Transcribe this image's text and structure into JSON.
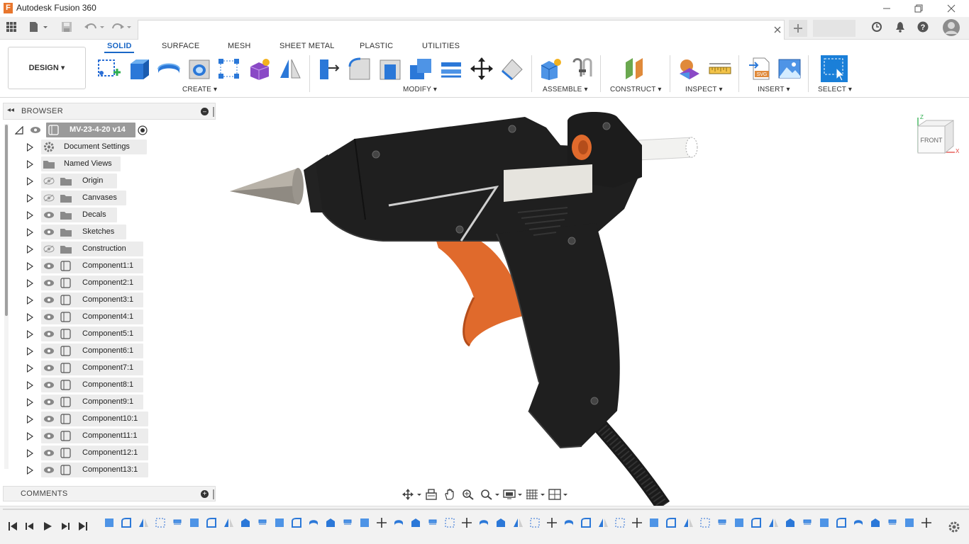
{
  "window": {
    "title": "Autodesk Fusion 360",
    "controls": [
      "minimize",
      "restore",
      "close"
    ]
  },
  "tabbar": {
    "icons": [
      "apps-grid-icon",
      "file-icon",
      "save-icon",
      "undo-icon",
      "redo-icon",
      "close-tab-icon",
      "new-tab-icon",
      "job-status-icon",
      "notifications-icon",
      "help-icon",
      "user-avatar"
    ]
  },
  "workspace": {
    "label": "DESIGN ▾"
  },
  "ribbon_tabs": [
    {
      "label": "SOLID",
      "active": true
    },
    {
      "label": "SURFACE",
      "active": false
    },
    {
      "label": "MESH",
      "active": false
    },
    {
      "label": "SHEET METAL",
      "active": false
    },
    {
      "label": "PLASTIC",
      "active": false
    },
    {
      "label": "UTILITIES",
      "active": false
    }
  ],
  "groups": {
    "create": "CREATE ▾",
    "modify": "MODIFY ▾",
    "assemble": "ASSEMBLE ▾",
    "construct": "CONSTRUCT ▾",
    "inspect": "INSPECT ▾",
    "insert": "INSERT ▾",
    "select": "SELECT ▾"
  },
  "browser": {
    "title": "BROWSER",
    "root": "MV-23-4-20 v14",
    "items": [
      {
        "label": "Document Settings",
        "icon": "gear-icon",
        "visibility": "none"
      },
      {
        "label": "Named Views",
        "icon": "folder-icon",
        "visibility": "none"
      },
      {
        "label": "Origin",
        "icon": "folder-icon",
        "visibility": "hidden"
      },
      {
        "label": "Canvases",
        "icon": "folder-icon",
        "visibility": "hidden"
      },
      {
        "label": "Decals",
        "icon": "folder-icon",
        "visibility": "visible"
      },
      {
        "label": "Sketches",
        "icon": "folder-icon",
        "visibility": "visible"
      },
      {
        "label": "Construction",
        "icon": "folder-icon",
        "visibility": "hidden"
      },
      {
        "label": "Component1:1",
        "icon": "component-icon",
        "visibility": "visible"
      },
      {
        "label": "Component2:1",
        "icon": "component-icon",
        "visibility": "visible"
      },
      {
        "label": "Component3:1",
        "icon": "component-icon",
        "visibility": "visible"
      },
      {
        "label": "Component4:1",
        "icon": "component-icon",
        "visibility": "visible"
      },
      {
        "label": "Component5:1",
        "icon": "component-icon",
        "visibility": "visible"
      },
      {
        "label": "Component6:1",
        "icon": "component-icon",
        "visibility": "visible"
      },
      {
        "label": "Component7:1",
        "icon": "component-icon",
        "visibility": "visible"
      },
      {
        "label": "Component8:1",
        "icon": "component-icon",
        "visibility": "visible"
      },
      {
        "label": "Component9:1",
        "icon": "component-icon",
        "visibility": "visible"
      },
      {
        "label": "Component10:1",
        "icon": "component-icon",
        "visibility": "visible"
      },
      {
        "label": "Component11:1",
        "icon": "component-icon",
        "visibility": "visible"
      },
      {
        "label": "Component12:1",
        "icon": "component-icon",
        "visibility": "visible"
      },
      {
        "label": "Component13:1",
        "icon": "component-icon",
        "visibility": "visible"
      }
    ]
  },
  "comments": {
    "title": "COMMENTS"
  },
  "viewcube": {
    "top_axis": "Z",
    "face": "FRONT",
    "side_axis": "X"
  },
  "model": {
    "description": "glue-gun-model",
    "body_color": "#1f1f1f",
    "trigger_color": "#e06a2c",
    "nozzle_color": "#b8b2a8"
  },
  "colors": {
    "accent": "#1a67c6",
    "ribbon_tab_active": "#1a67c6"
  }
}
